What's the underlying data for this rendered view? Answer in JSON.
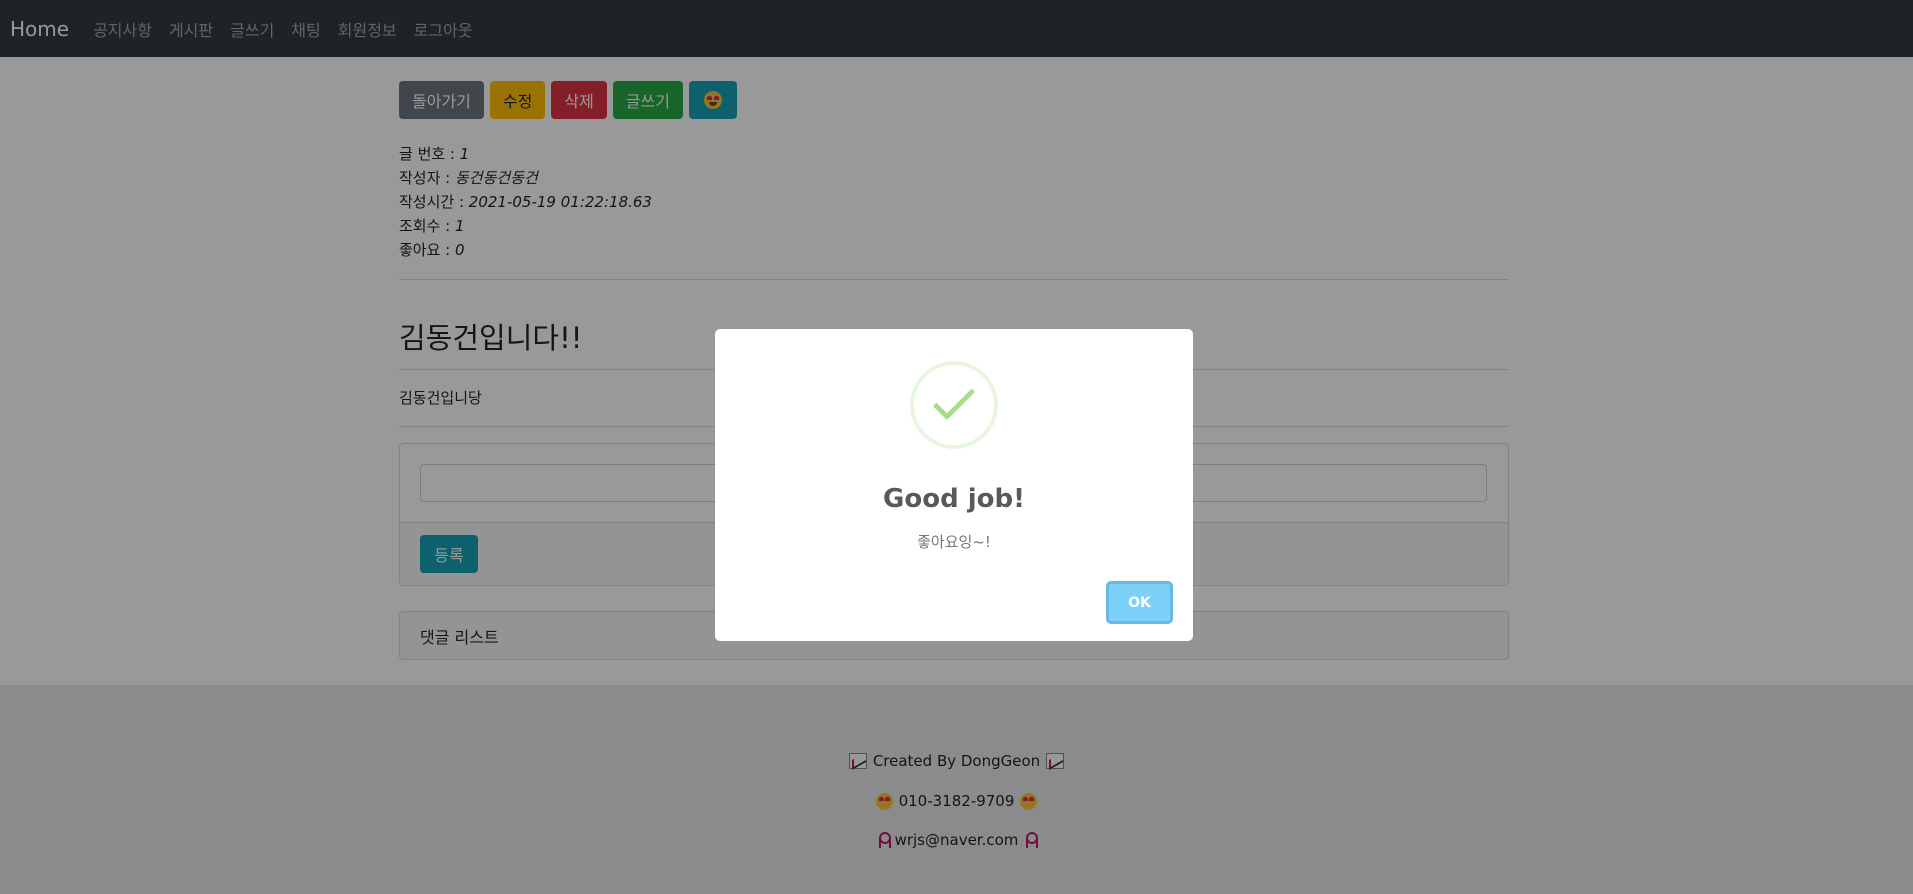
{
  "navbar": {
    "brand": "Home",
    "links": [
      "공지사항",
      "게시판",
      "글쓰기",
      "채팅",
      "회원정보",
      "로그아웃"
    ]
  },
  "actions": {
    "back": "돌아가기",
    "edit": "수정",
    "delete": "삭제",
    "write": "글쓰기",
    "like_icon": "heart-eyes-emoji-icon"
  },
  "meta": {
    "number_label": "글 번호 : ",
    "number": "1",
    "author_label": "작성자 : ",
    "author": "동건동건동건",
    "time_label": "작성시간 : ",
    "time": "2021-05-19 01:22:18.63",
    "views_label": "조회수 : ",
    "views": "1",
    "likes_label": "좋아요 : ",
    "likes": "0"
  },
  "post": {
    "title": "김동건입니다!!",
    "body": "김동건입니당"
  },
  "comment": {
    "textarea_value": "",
    "submit_label": "등록",
    "list_header": "댓글 리스트"
  },
  "footer": {
    "created_by": "Created By DongGeon",
    "phone": "010-3182-9709",
    "email": "wrjs@naver.com"
  },
  "modal": {
    "title": "Good job!",
    "text": "좋아요잉~!",
    "ok_label": "OK",
    "icon": "success-check-icon",
    "button_color": "#7cd1f9",
    "check_color": "#a5dc86"
  }
}
